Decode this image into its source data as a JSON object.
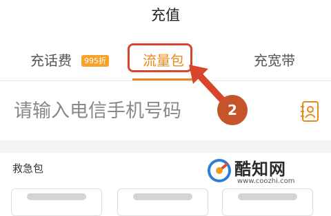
{
  "header": {
    "title": "充值"
  },
  "tabs": [
    {
      "label": "充话费",
      "badge": "995折",
      "active": false
    },
    {
      "label": "流量包",
      "active": true
    },
    {
      "label": "充宽带",
      "active": false
    }
  ],
  "phone": {
    "placeholder": "请输入电信手机号码",
    "contacts_icon": "contacts-icon"
  },
  "annotation": {
    "step": "2",
    "color": "#d8452c"
  },
  "section": {
    "title": "救急包"
  },
  "watermark": {
    "name": "酷知网",
    "url": "www.coozhi.com"
  },
  "colors": {
    "accent": "#e8891c",
    "badge": "#f7a22b",
    "annotation": "#d8452c"
  }
}
